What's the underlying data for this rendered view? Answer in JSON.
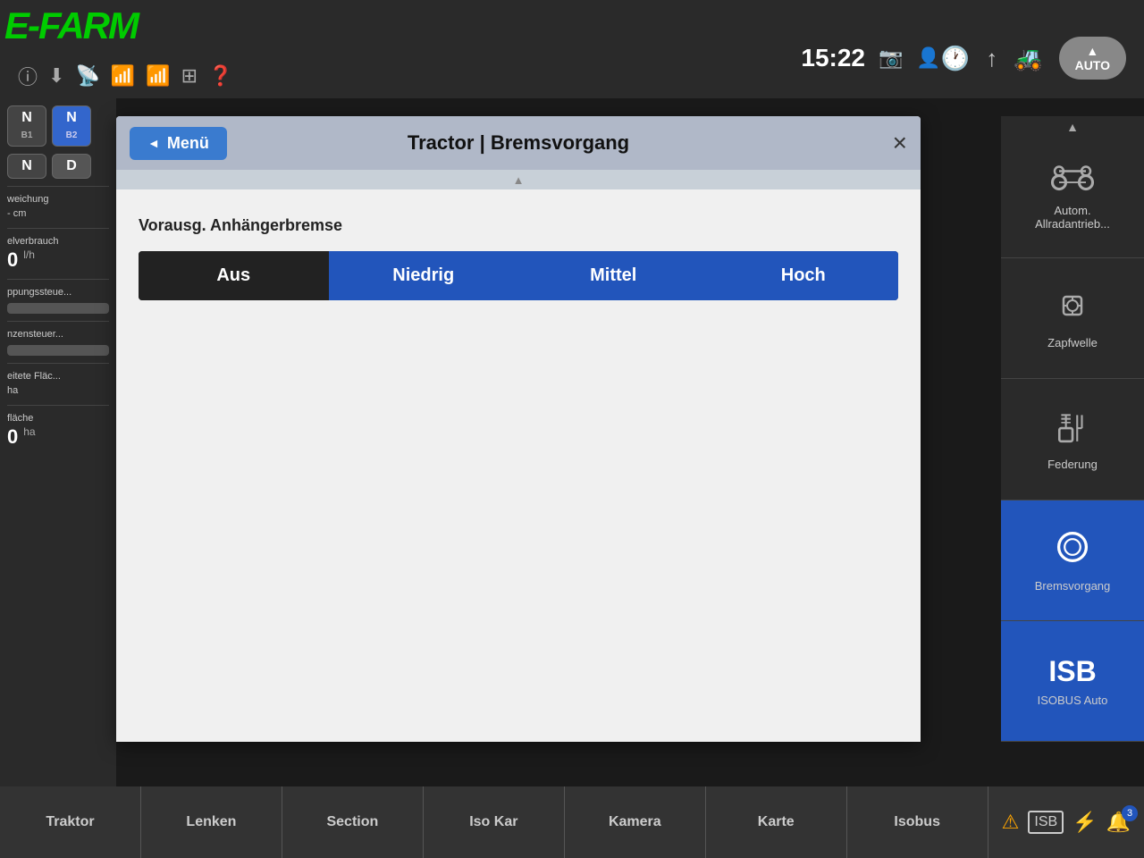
{
  "app": {
    "logo": "E-FARM",
    "time": "15:22",
    "auto_label": "AUTO"
  },
  "header": {
    "menu_label": "Menü",
    "title": "Tractor | Bremsvorgang",
    "close_symbol": "×"
  },
  "dialog": {
    "section_label": "Vorausg. Anhängerbremse",
    "brake_options": [
      {
        "label": "Aus",
        "selected": true
      },
      {
        "label": "Niedrig",
        "selected": false
      },
      {
        "label": "Mittel",
        "selected": false
      },
      {
        "label": "Hoch",
        "selected": false
      }
    ]
  },
  "right_panel": {
    "items": [
      {
        "id": "allrad",
        "label": "Autom. Allradantrieb...",
        "icon": "🚜"
      },
      {
        "id": "zapfwelle",
        "label": "Zapfwelle",
        "icon": "⚙"
      },
      {
        "id": "federung",
        "label": "Federung",
        "icon": "🔧"
      },
      {
        "id": "bremsvorgang",
        "label": "Bremsvorgang",
        "icon": "⊙",
        "active": true
      },
      {
        "id": "isobus",
        "label": "ISOBUS Auto",
        "isb": true
      }
    ]
  },
  "sidebar": {
    "items": [
      {
        "label": "N",
        "sub": "B1"
      },
      {
        "label": "N",
        "sub": "B2"
      }
    ],
    "gear": "N",
    "gear_sub": "D",
    "sections": [
      {
        "label": "weichung",
        "unit": "cm",
        "value": "-"
      },
      {
        "label": "elverbrauch",
        "unit": "l/h",
        "value": "0"
      },
      {
        "label": "ppungssteue..."
      },
      {
        "label": "nzensteuer..."
      },
      {
        "label": "eitete Fläc...",
        "unit": "ha",
        "value": ""
      },
      {
        "label": "fläche",
        "unit": "ha",
        "value": "0"
      }
    ]
  },
  "bottom_tabs": [
    {
      "label": "Traktor",
      "active": false
    },
    {
      "label": "Lenken",
      "active": false
    },
    {
      "label": "Section",
      "active": false
    },
    {
      "label": "Iso Kar",
      "active": false
    },
    {
      "label": "Kamera",
      "active": false
    },
    {
      "label": "Karte",
      "active": false
    },
    {
      "label": "Isobus",
      "active": false
    }
  ],
  "bottom_status": {
    "notification_count": "3"
  }
}
